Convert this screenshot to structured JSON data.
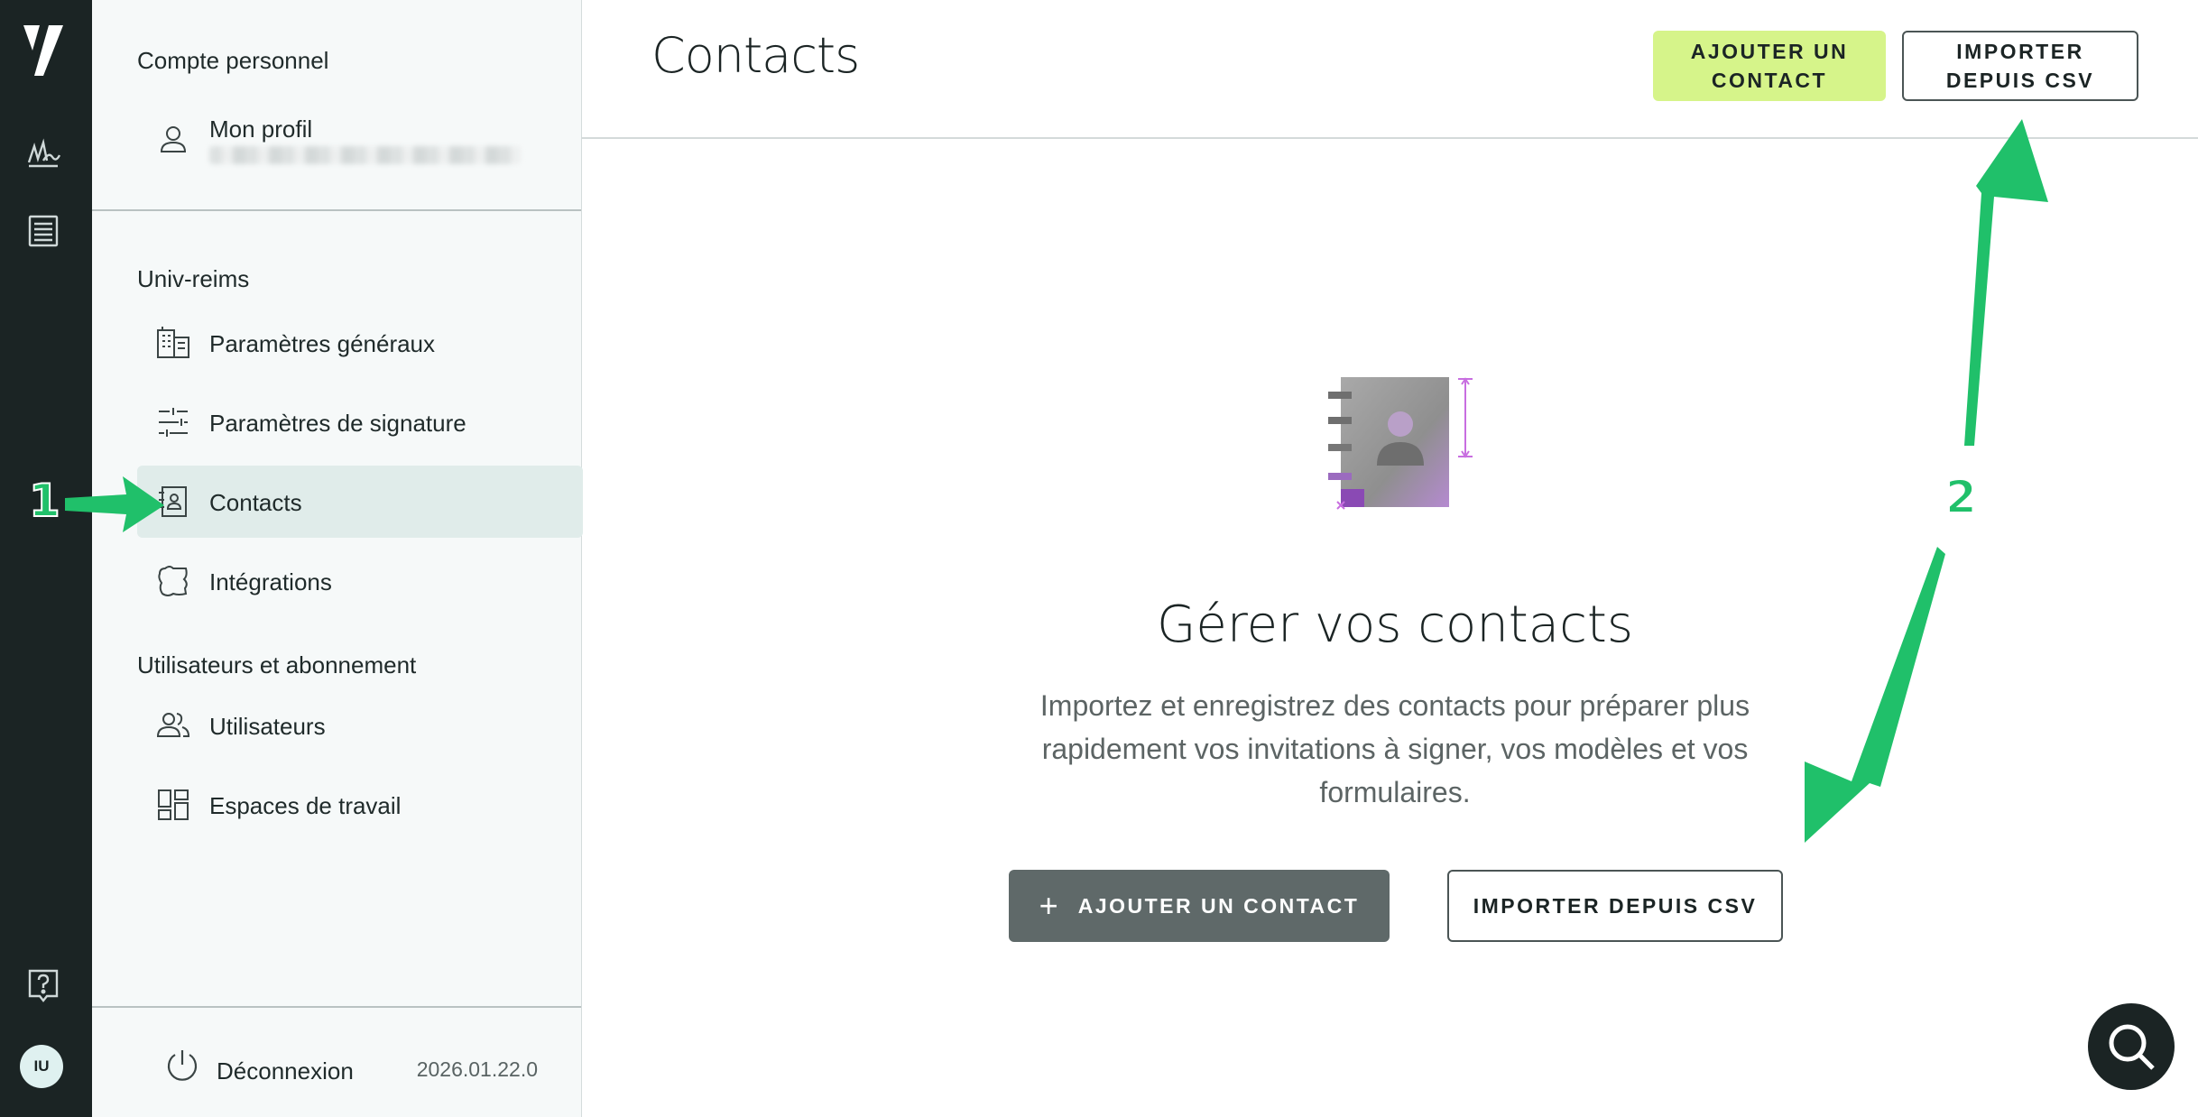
{
  "rail": {
    "logo_icon": "brand-slash-logo",
    "items": [
      {
        "icon": "signature-icon"
      },
      {
        "icon": "document-list-icon"
      }
    ],
    "help_icon": "help-question-icon",
    "avatar_initials": "IU"
  },
  "sidebar": {
    "personal_section_title": "Compte personnel",
    "profile": {
      "label": "Mon profil",
      "icon": "user-icon"
    },
    "org_section_title": "Univ-reims",
    "org_items": [
      {
        "label": "Paramètres généraux",
        "icon": "building-icon"
      },
      {
        "label": "Paramètres de signature",
        "icon": "sliders-icon"
      },
      {
        "label": "Contacts",
        "icon": "contact-book-icon",
        "active": true
      },
      {
        "label": "Intégrations",
        "icon": "puzzle-icon"
      }
    ],
    "users_section_title": "Utilisateurs et abonnement",
    "users_items": [
      {
        "label": "Utilisateurs",
        "icon": "users-icon"
      },
      {
        "label": "Espaces de travail",
        "icon": "workspaces-icon"
      }
    ],
    "logout_label": "Déconnexion",
    "version": "2026.01.22.0"
  },
  "header": {
    "title": "Contacts",
    "add_contact_label": "AJOUTER UN CONTACT",
    "import_csv_label": "IMPORTER DEPUIS CSV"
  },
  "empty_state": {
    "illustration": "address-book-illustration",
    "title": "Gérer vos contacts",
    "description": "Importez et enregistrez des contacts pour préparer plus rapidement vos invitations à signer, vos modèles et vos formulaires.",
    "add_contact_label": "AJOUTER UN CONTACT",
    "import_csv_label": "IMPORTER DEPUIS CSV"
  },
  "annotations": {
    "step_1": "1",
    "step_2": "2",
    "arrow_color": "#20c06a"
  },
  "colors": {
    "rail_bg": "#1b2424",
    "accent_lime": "#d6f48a",
    "active_item_bg": "#e0ecea",
    "dark_button": "#5f6969"
  },
  "help_fab_icon": "search-help-icon"
}
